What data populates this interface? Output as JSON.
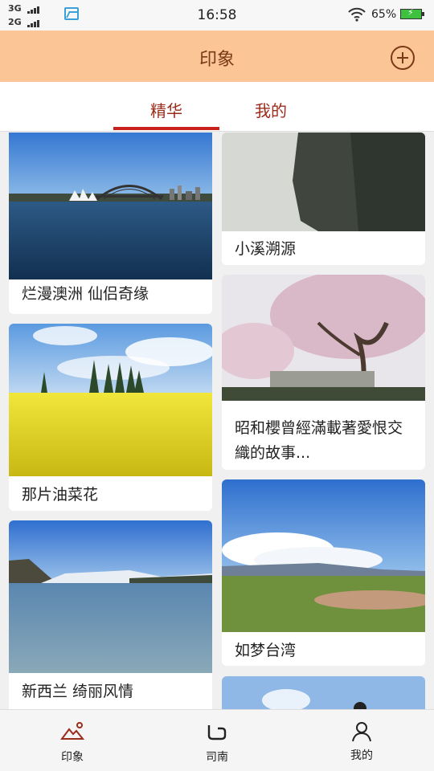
{
  "status_bar": {
    "signal_1": "3G",
    "signal_2": "2G",
    "time": "16:58",
    "battery": "65%"
  },
  "header": {
    "title": "印象",
    "add_icon": "plus-circle-icon"
  },
  "tabs": [
    {
      "label": "精华",
      "active": true
    },
    {
      "label": "我的",
      "active": false
    }
  ],
  "cards": [
    {
      "title": "烂漫澳洲 仙侣奇缘"
    },
    {
      "title": "那片油菜花"
    },
    {
      "title": "新西兰 绮丽风情"
    },
    {
      "title": "小溪溯源"
    },
    {
      "title": "昭和櫻曾經滿載著愛恨交織的故事..."
    },
    {
      "title": "如梦台湾"
    }
  ],
  "bottom_nav": [
    {
      "label": "印象",
      "icon": "mountain-icon",
      "active": true
    },
    {
      "label": "司南",
      "icon": "compass-route-icon",
      "active": false
    },
    {
      "label": "我的",
      "icon": "person-icon",
      "active": false
    }
  ],
  "colors": {
    "header_bg": "#fcc596",
    "accent": "#c8221b",
    "header_text": "#7b3a17"
  }
}
